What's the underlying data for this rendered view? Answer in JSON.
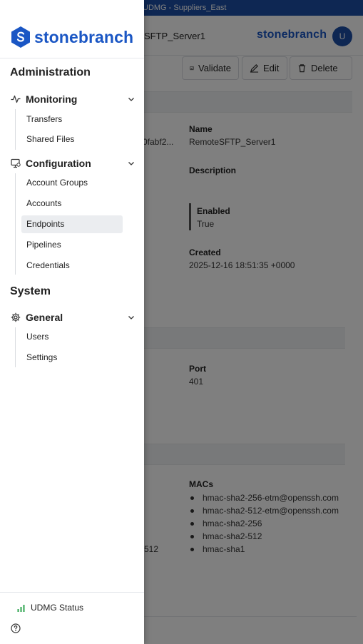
{
  "window": {
    "title": "UDMG - Suppliers_East"
  },
  "header": {
    "page_title": "SFTP_Server1",
    "logo": "stonebranch",
    "avatar": "U"
  },
  "toolbar": {
    "validate": "Validate",
    "edit": "Edit",
    "delete": "Delete"
  },
  "details": {
    "id_fragment": "0fabf2...",
    "name_label": "Name",
    "name_value": "RemoteSFTP_Server1",
    "description_label": "Description",
    "enabled_label": "Enabled",
    "enabled_value": "True",
    "created_label": "Created",
    "created_value": "2025-12-16 18:51:35 +0000",
    "port_label": "Port",
    "port_value": "401",
    "macs_label": "MACs",
    "macs": [
      "hmac-sha2-256-etm@openssh.com",
      "hmac-sha2-512-etm@openssh.com",
      "hmac-sha2-256",
      "hmac-sha2-512",
      "hmac-sha1"
    ],
    "left_fragment": "512"
  },
  "drawer": {
    "brand": "stonebranch",
    "administration": "Administration",
    "monitoring": {
      "label": "Monitoring",
      "icon": "activity-icon",
      "items": [
        "Transfers",
        "Shared Files"
      ]
    },
    "configuration": {
      "label": "Configuration",
      "icon": "monitor-settings-icon",
      "items": [
        "Account Groups",
        "Accounts",
        "Endpoints",
        "Pipelines",
        "Credentials"
      ],
      "active": "Endpoints"
    },
    "system": "System",
    "general": {
      "label": "General",
      "icon": "gear-icon",
      "items": [
        "Users",
        "Settings"
      ]
    },
    "status_label": "UDMG Status"
  },
  "colors": {
    "brand": "#1a56c4",
    "topbar": "#1d4fa6",
    "status_green": "#2ea44f"
  }
}
